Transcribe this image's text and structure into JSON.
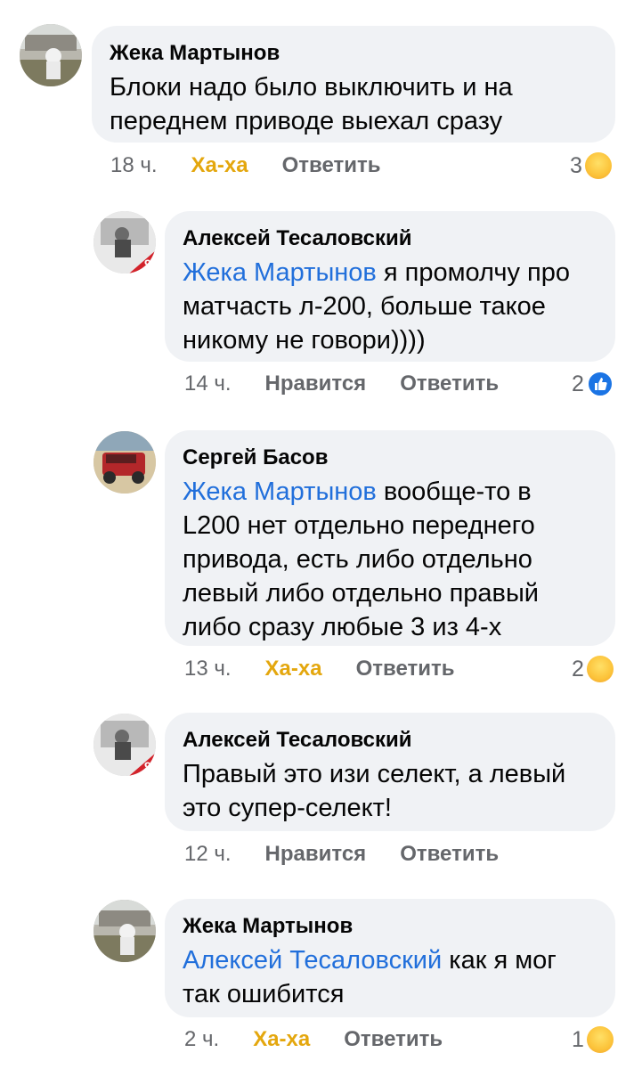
{
  "comments": [
    {
      "author": "Жека Мартынов",
      "mention": "",
      "text_line1": "Блоки надо было выключить и на",
      "text_line2": "переднем приводе выехал сразу",
      "text_line3": "",
      "text_line4": "",
      "text_line5": "",
      "time": "18 ч.",
      "reaction_action": "Ха-ха",
      "reply": "Ответить",
      "reaction_count": "3",
      "reaction_icon": "haha-emoji-icon"
    },
    {
      "author": "Алексей Тесаловский",
      "mention": "Жека Мартынов",
      "text_line1": " я промолчу про",
      "text_line2": "матчасть л-200, больше такое",
      "text_line3": "никому не говори))))",
      "time": "14 ч.",
      "reaction_action": "Нравится",
      "reply": "Ответить",
      "reaction_count": "2",
      "reaction_icon": "like-icon"
    },
    {
      "author": "Сергей Басов",
      "mention": "Жека Мартынов",
      "text_line1": " вообще-то в",
      "text_line2": "L200 нет отдельно переднего",
      "text_line3": "привода, есть либо отдельно",
      "text_line4": "левый либо отдельно правый",
      "text_line5": "либо сразу любые 3 из 4-х",
      "time": "13 ч.",
      "reaction_action": "Ха-ха",
      "reply": "Ответить",
      "reaction_count": "2",
      "reaction_icon": "haha-emoji-icon"
    },
    {
      "author": "Алексей Тесаловский",
      "mention": "",
      "text_line1": "Правый это изи селект, а левый",
      "text_line2": "это супер-селект!",
      "time": "12 ч.",
      "reaction_action": "Нравится",
      "reply": "Ответить",
      "reaction_count": "",
      "reaction_icon": ""
    },
    {
      "author": "Жека Мартынов",
      "mention": "Алексей Тесаловский",
      "text_line1": " как я мог",
      "text_line2": "так ошибится",
      "time": "2 ч.",
      "reaction_action": "Ха-ха",
      "reply": "Ответить",
      "reaction_count": "1",
      "reaction_icon": "haha-emoji-icon"
    }
  ],
  "colors": {
    "bubble": "#f0f2f5",
    "mention": "#216fdb",
    "haha_action": "#e4a70e",
    "meta_text": "#65676b",
    "like_blue": "#1b74e4"
  }
}
